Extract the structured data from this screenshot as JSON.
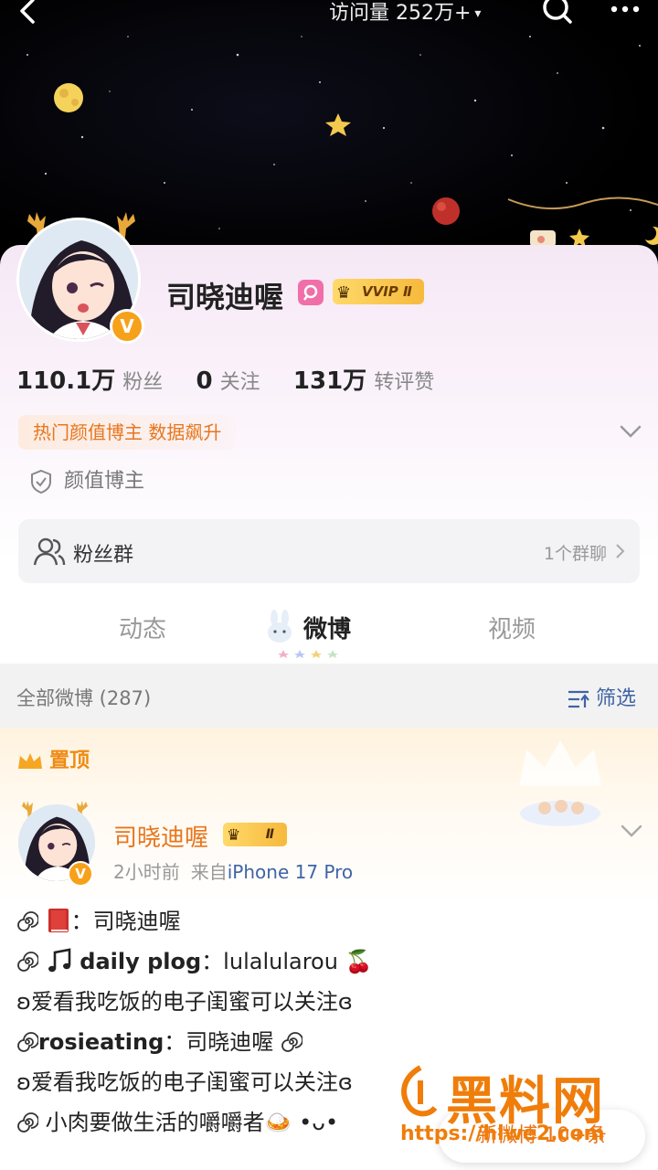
{
  "topbar": {
    "visits_label": "访问量 252万+",
    "visits_caret": "▾"
  },
  "profile": {
    "name": "司晓迪喔",
    "vip_badge": "VVIP",
    "vip_level": "Ⅱ",
    "verified_mark": "V",
    "stats": [
      {
        "num": "110.1万",
        "label": "粉丝"
      },
      {
        "num": "0",
        "label": "关注"
      },
      {
        "num": "131万",
        "label": "转评赞"
      }
    ],
    "hot_tag": "热门颜值博主 数据飙升",
    "cert": "颜值博主",
    "fans_group": {
      "label": "粉丝群",
      "count": "1个群聊"
    }
  },
  "tabs": [
    {
      "label": "动态",
      "active": false
    },
    {
      "label": "微博",
      "active": true
    },
    {
      "label": "视频",
      "active": false
    }
  ],
  "filterbar": {
    "all_label": "全部微博 (287)",
    "filter_label": "筛选"
  },
  "post": {
    "pinned_label": "置顶",
    "author": "司晓迪喔",
    "author_badge_level": "Ⅱ",
    "time": "2小时前",
    "source_prefix": "来自",
    "device": "iPhone 17 Pro",
    "lines": {
      "l1_text": "：司晓迪喔",
      "l2_bold": "daily plog",
      "l2_text": "：lulalularou 🍒",
      "l3_text": "ʚ爱看我吃饭的电子闺蜜可以关注ɞ",
      "l4_bold": "rosieating",
      "l4_text": "：司晓迪喔",
      "l5_text": "ʚ爱看我吃饭的电子闺蜜可以关注ɞ",
      "l6_text": " 小肉要做生活的嚼嚼者🍛 •ᴗ•"
    }
  },
  "new_posts_pill": "新微博 10+条",
  "watermark": {
    "brand": "黑料网",
    "url": "https://hlwe2.com"
  },
  "colors": {
    "accent_orange": "#e8761c",
    "link_blue": "#3f64a6",
    "verified_gold": "#f7a11a",
    "vip_gold": "#f6b93c"
  }
}
